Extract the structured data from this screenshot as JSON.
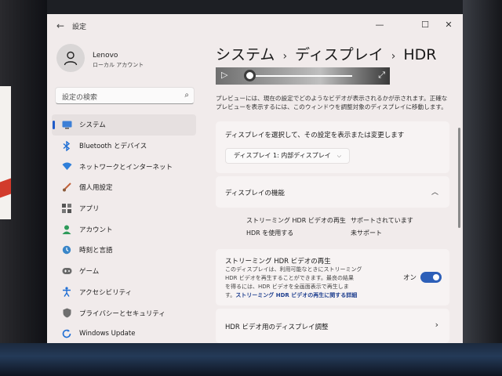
{
  "window": {
    "title": "設定",
    "controls": {
      "minimize": "—",
      "maximize": "☐",
      "close": "✕"
    }
  },
  "profile": {
    "name": "Lenovo",
    "account_type": "ローカル アカウント"
  },
  "search": {
    "placeholder": "設定の検索"
  },
  "sidebar": {
    "items": [
      {
        "label": "システム",
        "icon": "monitor-icon",
        "active": true
      },
      {
        "label": "Bluetooth とデバイス",
        "icon": "bluetooth-icon"
      },
      {
        "label": "ネットワークとインターネット",
        "icon": "wifi-icon"
      },
      {
        "label": "個人用設定",
        "icon": "brush-icon"
      },
      {
        "label": "アプリ",
        "icon": "apps-icon"
      },
      {
        "label": "アカウント",
        "icon": "person-icon"
      },
      {
        "label": "時刻と言語",
        "icon": "globe-clock-icon"
      },
      {
        "label": "ゲーム",
        "icon": "gamepad-icon"
      },
      {
        "label": "アクセシビリティ",
        "icon": "accessibility-icon"
      },
      {
        "label": "プライバシーとセキュリティ",
        "icon": "shield-icon"
      },
      {
        "label": "Windows Update",
        "icon": "update-icon"
      }
    ]
  },
  "breadcrumb": {
    "level1": "システム",
    "level2": "ディスプレイ",
    "current": "HDR",
    "separator": "›"
  },
  "preview": {
    "note": "プレビューには、現在の設定でどのようなビデオが表示されるかが示されます。正確なプレビューを表示するには、このウィンドウを調整対象のディスプレイに移動します。"
  },
  "display_select": {
    "label": "ディスプレイを選択して、その設定を表示または変更します",
    "selected": "ディスプレイ 1: 内部ディスプレイ"
  },
  "capabilities": {
    "title": "ディスプレイの機能",
    "rows": [
      {
        "name": "ストリーミング HDR ビデオの再生",
        "value": "サポートされています"
      },
      {
        "name": "HDR を使用する",
        "value": "未サポート"
      }
    ]
  },
  "streaming_hdr": {
    "title": "ストリーミング HDR ビデオの再生",
    "desc_line1": "このディスプレイは、利用可能なときにストリーミング",
    "desc_line2": "HDR ビデオを再生することができます。最良の結果",
    "desc_line3": "を得るには、HDR ビデオを全画面表示で再生しま",
    "desc_line4_prefix": "す。",
    "link": "ストリーミング HDR ビデオの再生に関する詳細",
    "state_label": "オン",
    "on": true
  },
  "hdr_calibration": {
    "label": "HDR ビデオ用のディスプレイ調整"
  },
  "colors": {
    "accent": "#2d5fb8",
    "link": "#1f3f8f"
  }
}
